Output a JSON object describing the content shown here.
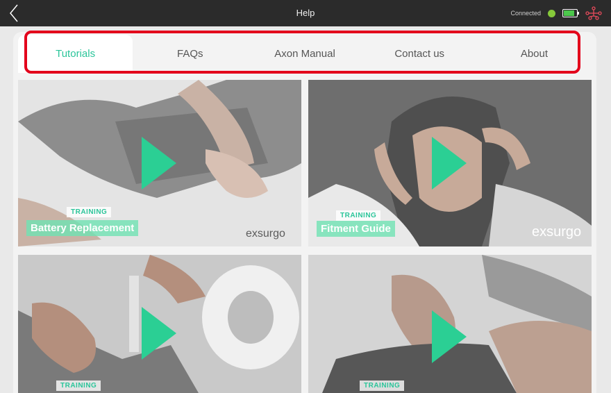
{
  "top_bar": {
    "title": "Help",
    "connection_status": "Connected",
    "back_icon": "chevron-left-icon",
    "network_icon": "network-icon"
  },
  "colors": {
    "accent": "#2bc59a",
    "play": "#2bcf94",
    "highlight_border": "#e3001b",
    "topbar": "#2b2b2b",
    "connected_dot": "#86c93a"
  },
  "tabs": [
    {
      "label": "Tutorials",
      "active": true
    },
    {
      "label": "FAQs",
      "active": false
    },
    {
      "label": "Axon Manual",
      "active": false
    },
    {
      "label": "Contact us",
      "active": false
    },
    {
      "label": "About",
      "active": false
    }
  ],
  "tutorials": [
    {
      "tag": "TRAINING",
      "title": "Battery Replacement",
      "brand": "exsurgo"
    },
    {
      "tag": "TRAINING",
      "title": "Fitment Guide",
      "brand": "exsurgo"
    },
    {
      "tag": "TRAINING",
      "title": ""
    },
    {
      "tag": "TRAINING",
      "title": ""
    }
  ]
}
